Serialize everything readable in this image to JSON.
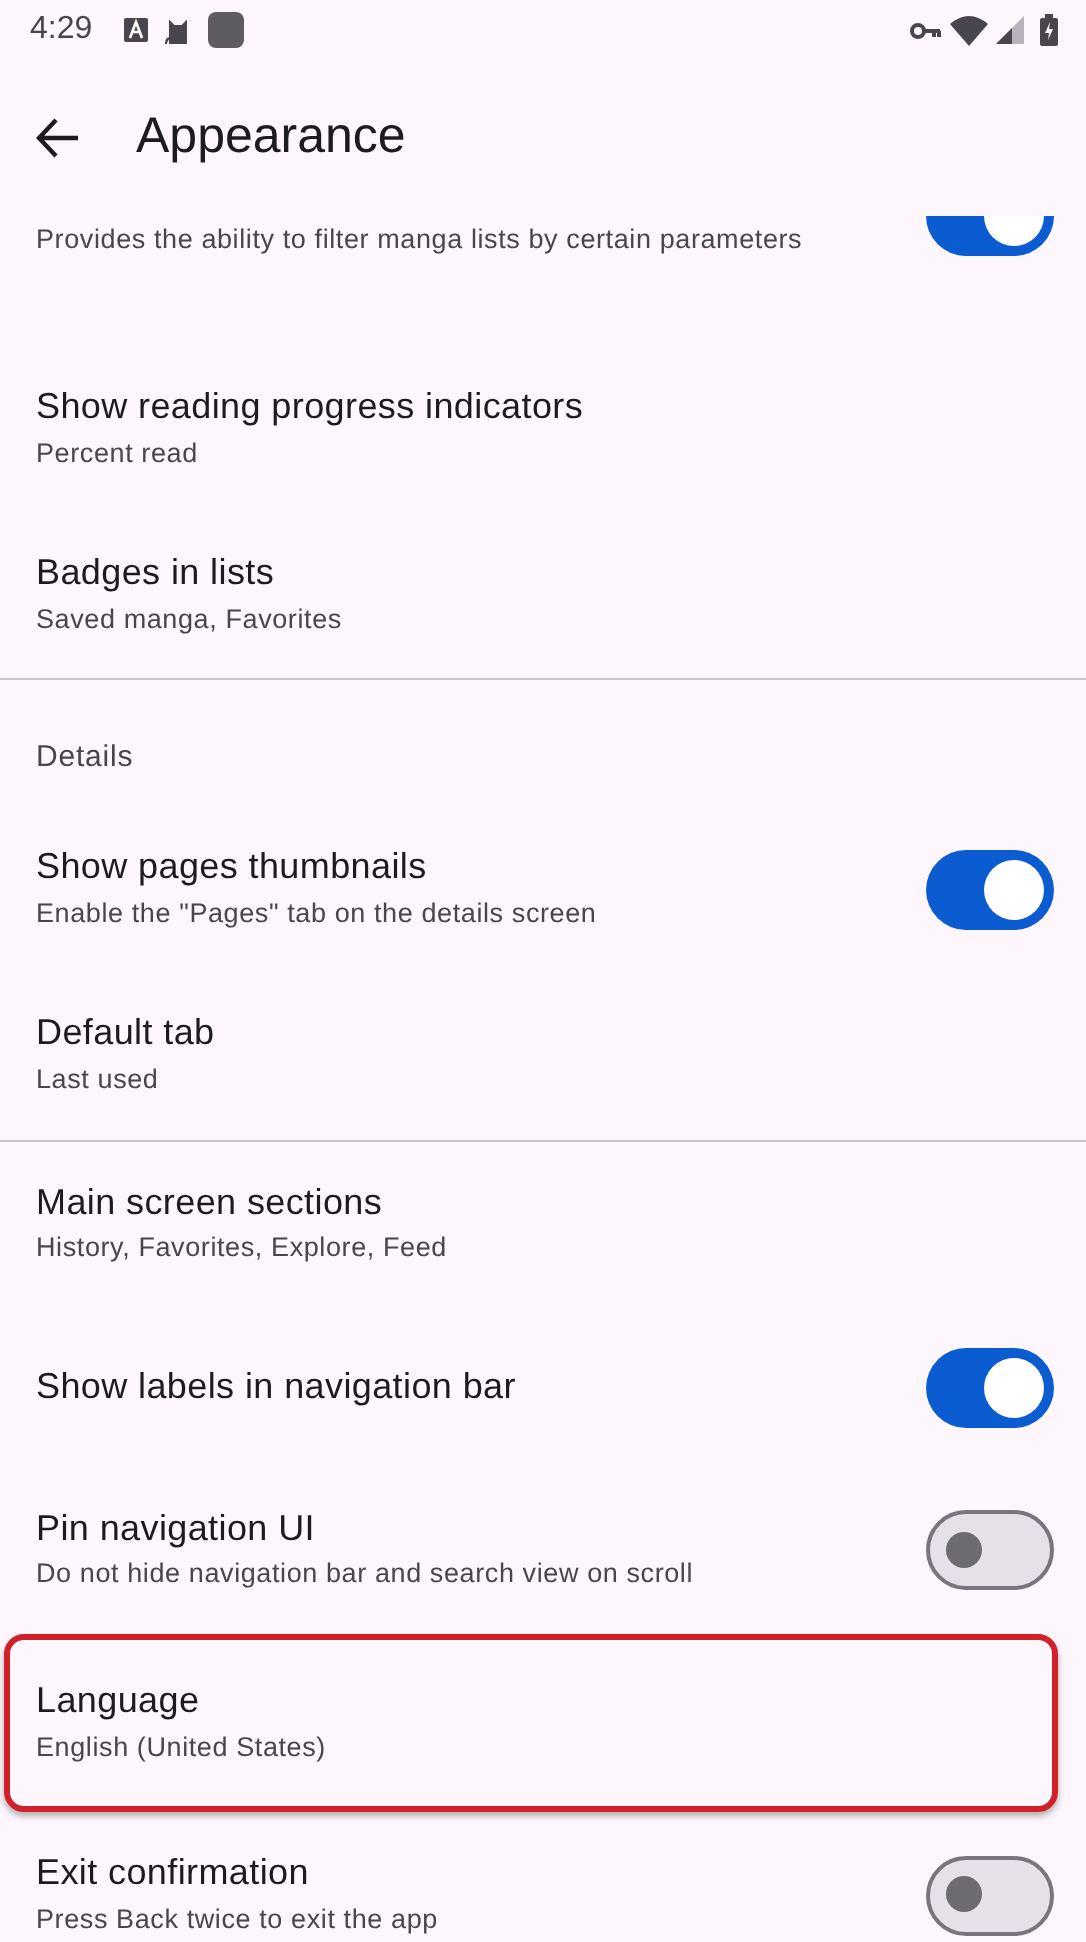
{
  "status_bar": {
    "time": "4:29"
  },
  "toolbar": {
    "title": "Appearance"
  },
  "items": [
    {
      "kind": "item",
      "subtitle": "Provides the ability to filter manga lists by certain parameters",
      "switch": {
        "on": true
      }
    },
    {
      "kind": "item",
      "title": "Show reading progress indicators",
      "subtitle": "Percent read"
    },
    {
      "kind": "item",
      "title": "Badges in lists",
      "subtitle": "Saved manga, Favorites"
    },
    {
      "kind": "divider"
    },
    {
      "kind": "header",
      "title": "Details"
    },
    {
      "kind": "item",
      "title": "Show pages thumbnails",
      "subtitle": "Enable the \"Pages\" tab on the details screen",
      "switch": {
        "on": true
      }
    },
    {
      "kind": "item",
      "title": "Default tab",
      "subtitle": "Last used"
    },
    {
      "kind": "divider"
    },
    {
      "kind": "item",
      "title": "Main screen sections",
      "subtitle": "History, Favorites, Explore, Feed"
    },
    {
      "kind": "item",
      "title": "Show labels in navigation bar",
      "switch": {
        "on": true
      }
    },
    {
      "kind": "item",
      "title": "Pin navigation UI",
      "subtitle": "Do not hide navigation bar and search view on scroll",
      "switch": {
        "on": false
      }
    },
    {
      "kind": "item",
      "title": "Language",
      "subtitle": "English (United States)",
      "highlighted": true
    },
    {
      "kind": "item",
      "title": "Exit confirmation",
      "subtitle": "Press Back twice to exit the app",
      "switch": {
        "on": false
      }
    }
  ]
}
